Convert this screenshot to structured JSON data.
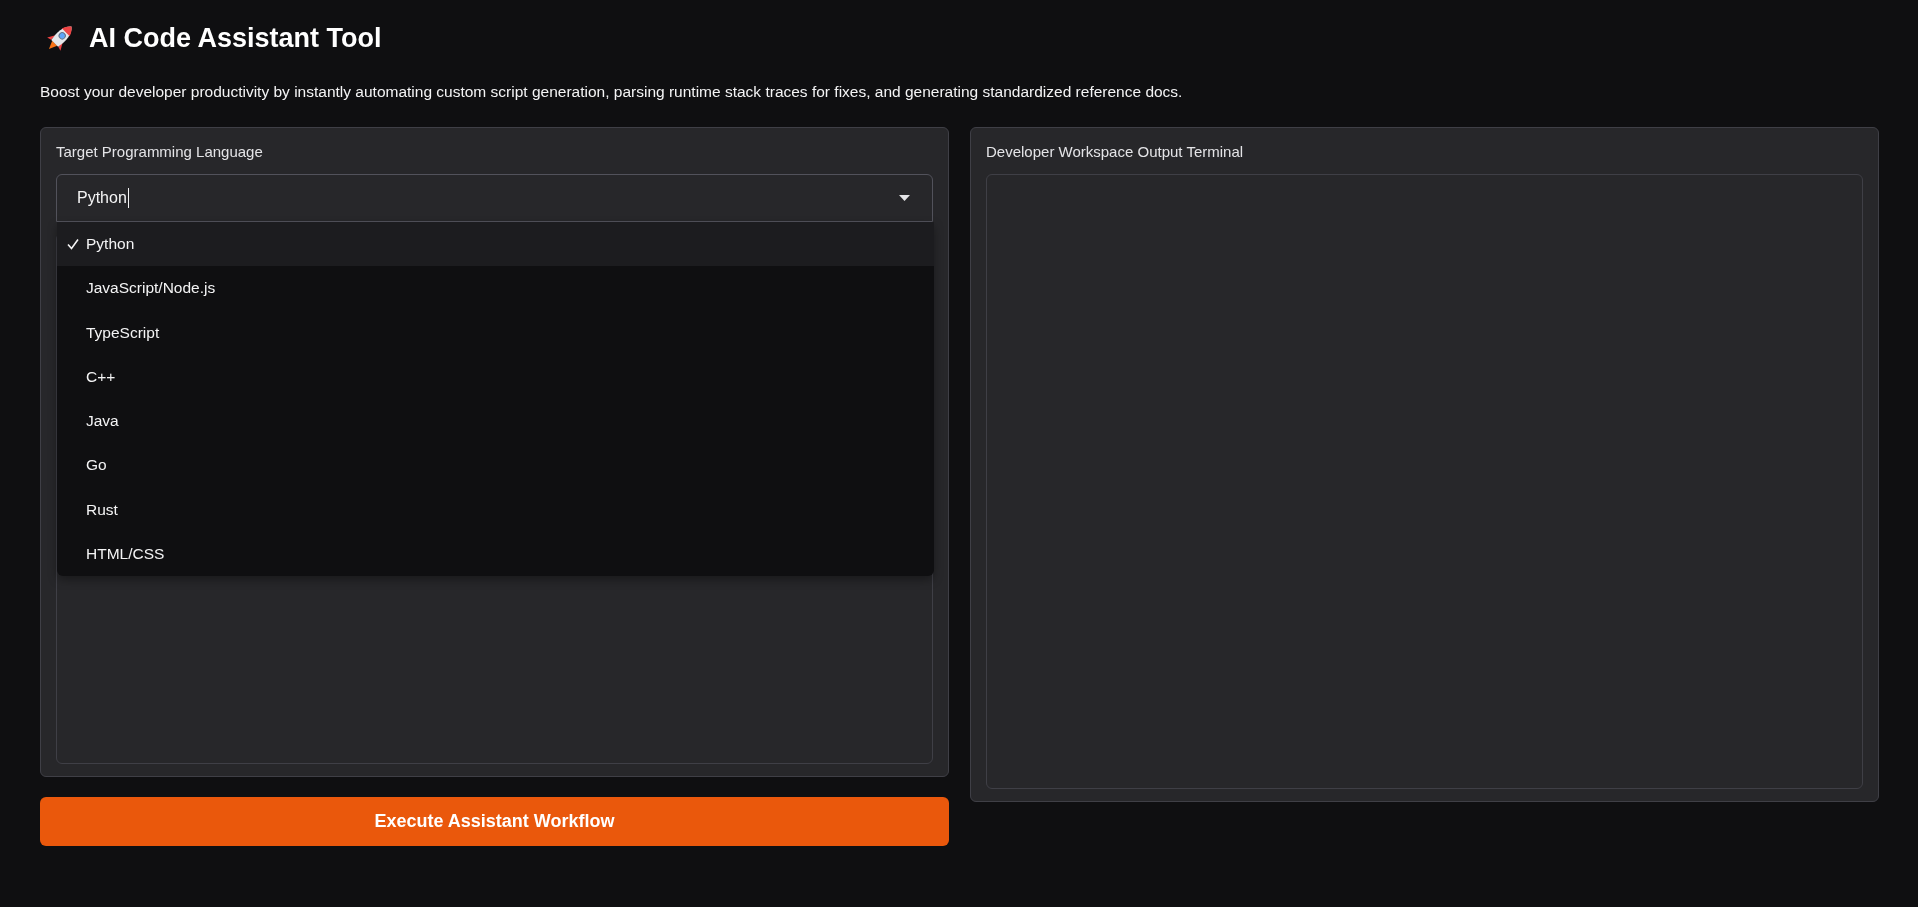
{
  "header": {
    "title": "AI Code Assistant Tool",
    "description": "Boost your developer productivity by instantly automating custom script generation, parsing runtime stack traces for fixes, and generating standardized reference docs."
  },
  "input_panel": {
    "language_select": {
      "label": "Target Programming Language",
      "value": "Python",
      "focused": true,
      "expanded": true,
      "options": [
        {
          "label": "Python",
          "selected": true
        },
        {
          "label": "JavaScript/Node.js",
          "selected": false
        },
        {
          "label": "TypeScript",
          "selected": false
        },
        {
          "label": "C++",
          "selected": false
        },
        {
          "label": "Java",
          "selected": false
        },
        {
          "label": "Go",
          "selected": false
        },
        {
          "label": "Rust",
          "selected": false
        },
        {
          "label": "HTML/CSS",
          "selected": false
        }
      ]
    }
  },
  "run_button": {
    "label": "Execute Assistant Workflow"
  },
  "output_panel": {
    "label": "Developer Workspace Output Terminal"
  }
}
